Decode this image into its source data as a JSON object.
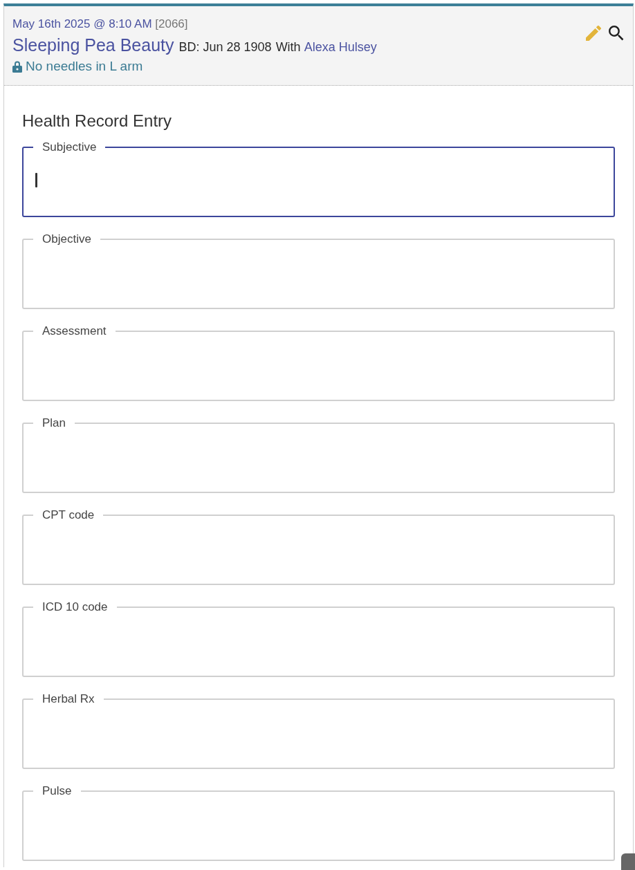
{
  "header": {
    "visit_datetime": "May 16th 2025 @ 8:10 AM",
    "record_number": "[2066]",
    "patient_name": "Sleeping Pea Beauty",
    "birthdate": "BD: Jun 28 1908",
    "with_label": "With",
    "provider": "Alexa Hulsey",
    "alert": "No needles in L arm"
  },
  "form": {
    "title": "Health Record Entry",
    "fields": [
      {
        "label": "Subjective",
        "focused": true
      },
      {
        "label": "Objective",
        "focused": false
      },
      {
        "label": "Assessment",
        "focused": false
      },
      {
        "label": "Plan",
        "focused": false
      },
      {
        "label": "CPT code",
        "focused": false
      },
      {
        "label": "ICD 10 code",
        "focused": false
      },
      {
        "label": "Herbal Rx",
        "focused": false
      },
      {
        "label": "Pulse",
        "focused": false
      }
    ]
  }
}
